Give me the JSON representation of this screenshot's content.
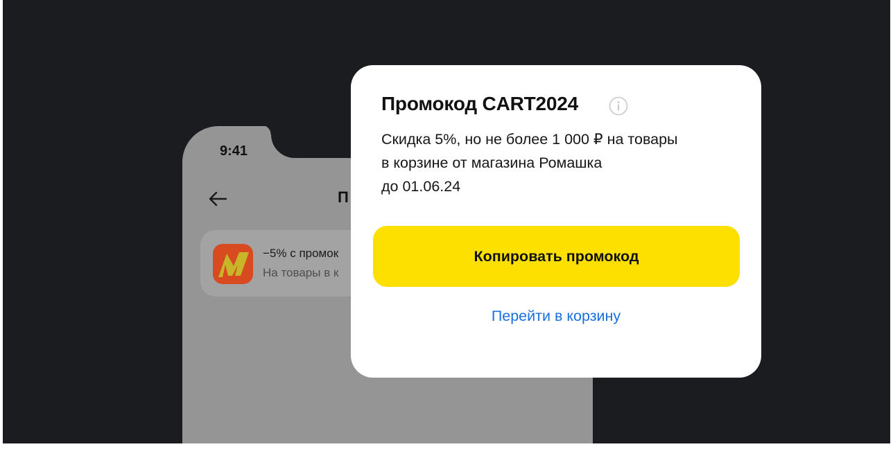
{
  "phone": {
    "status_time": "9:41",
    "screen_title": "П",
    "back_icon": "arrow-left-icon",
    "promo_item": {
      "logo": "market-logo",
      "line1": "−5% с промок",
      "line2": "На товары в к"
    }
  },
  "popup": {
    "title": "Промокод CART2024",
    "info_icon": "info-icon",
    "description_lines": [
      "Скидка 5%, но не более 1 000 ₽ на товары",
      "в корзине от магазина Ромашка",
      "до 01.06.24"
    ],
    "copy_button_label": "Копировать промокод",
    "cart_link_label": "Перейти в корзину"
  },
  "colors": {
    "backdrop": "#1b1c1f",
    "accent_button": "#fde000",
    "link": "#1a6fe0",
    "phone_screen": "#959595"
  }
}
